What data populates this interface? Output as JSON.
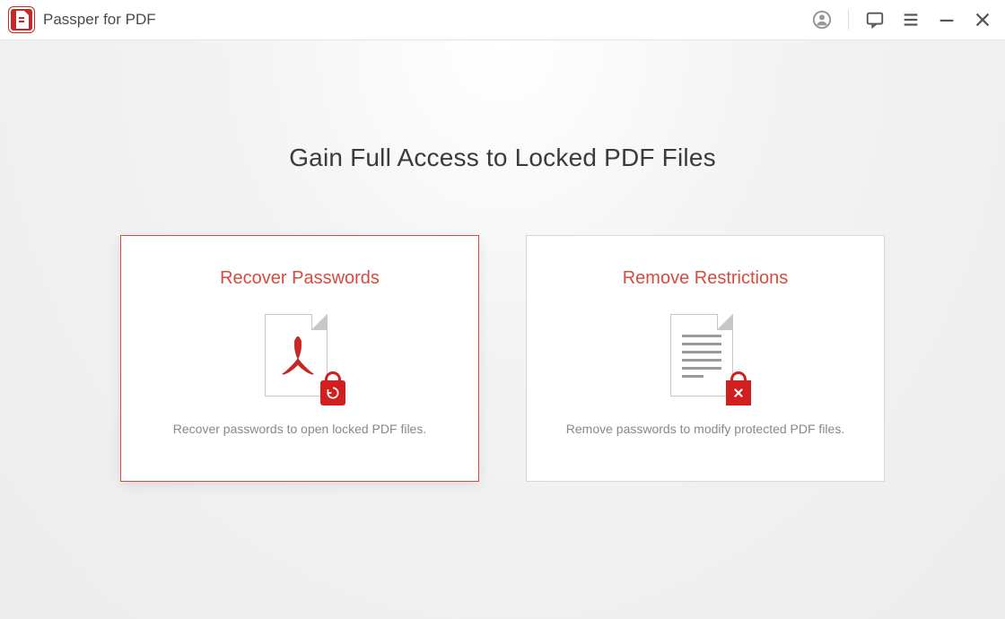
{
  "header": {
    "app_title": "Passper for PDF"
  },
  "main": {
    "heading": "Gain Full Access to Locked PDF Files",
    "cards": [
      {
        "title": "Recover Passwords",
        "description": "Recover passwords to open locked PDF files."
      },
      {
        "title": "Remove Restrictions",
        "description": "Remove passwords to modify protected PDF files."
      }
    ]
  }
}
